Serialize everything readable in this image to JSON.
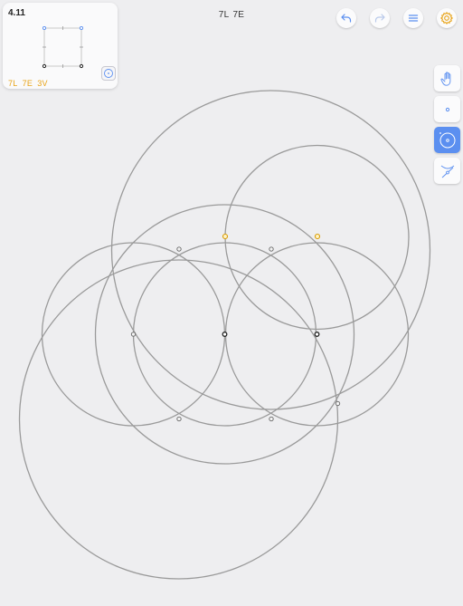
{
  "level": {
    "title": "4.11"
  },
  "scores": {
    "lines": "7L",
    "euclid": "7E",
    "verbs": "3V"
  },
  "toolbar": {
    "undo_icon": "undo-arrow-icon",
    "redo_icon": "redo-arrow-icon",
    "menu_icon": "hamburger-menu-icon",
    "settings_icon": "gear-icon"
  },
  "tools": [
    {
      "name": "hand",
      "icon": "hand-icon",
      "active": false
    },
    {
      "name": "point",
      "icon": "point-icon",
      "active": false
    },
    {
      "name": "circle",
      "icon": "circle-icon",
      "active": true
    },
    {
      "name": "intersect",
      "icon": "intersect-icon",
      "active": false
    }
  ],
  "colors": {
    "accent": "#5b8ff0",
    "score": "#e8a317",
    "curve": "#9a9a9a",
    "goal_point": "#f0b400",
    "background": "#eeeef0"
  }
}
